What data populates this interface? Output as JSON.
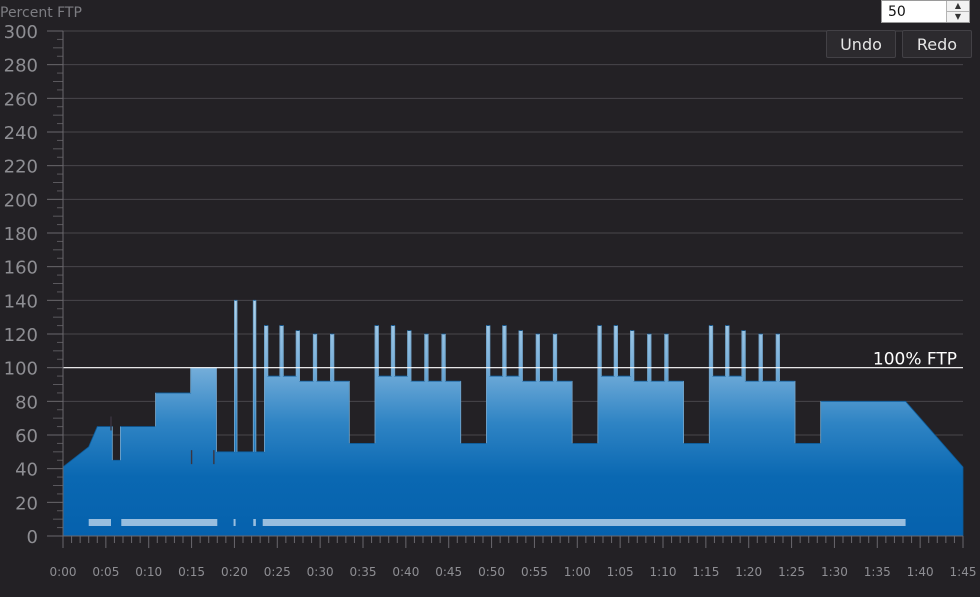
{
  "chart_data": {
    "type": "area",
    "title": "Percent FTP",
    "xlabel": "",
    "ylabel": "Percent FTP",
    "ylim": [
      0,
      300
    ],
    "xlim": [
      0,
      105
    ],
    "y_ticks": [
      0,
      20,
      40,
      60,
      80,
      100,
      120,
      140,
      160,
      180,
      200,
      220,
      240,
      260,
      280,
      300
    ],
    "x_tick_labels": [
      "0:00",
      "0:05",
      "0:10",
      "0:15",
      "0:20",
      "0:25",
      "0:30",
      "0:35",
      "0:40",
      "0:45",
      "0:50",
      "0:55",
      "1:00",
      "1:05",
      "1:10",
      "1:15",
      "1:20",
      "1:25",
      "1:30",
      "1:35",
      "1:40",
      "1:45"
    ],
    "grid": true,
    "reference_line": {
      "value": 100,
      "label": "100% FTP"
    },
    "color": "#1a6fb5",
    "profile": [
      [
        0.0,
        41
      ],
      [
        3.0,
        53
      ],
      [
        4.0,
        65
      ],
      [
        5.75,
        65
      ],
      [
        5.75,
        45
      ],
      [
        6.7,
        45
      ],
      [
        6.7,
        65
      ],
      [
        10.8,
        65
      ],
      [
        10.8,
        85
      ],
      [
        14.9,
        85
      ],
      [
        14.9,
        100
      ],
      [
        17.9,
        100
      ],
      [
        17.9,
        50
      ],
      [
        20.0,
        50
      ],
      [
        20.0,
        140
      ],
      [
        20.3,
        140
      ],
      [
        20.3,
        50
      ],
      [
        22.2,
        50
      ],
      [
        22.2,
        140
      ],
      [
        22.5,
        140
      ],
      [
        22.5,
        50
      ],
      [
        23.5,
        50
      ],
      [
        23.5,
        125
      ],
      [
        23.9,
        125
      ],
      [
        23.9,
        95
      ],
      [
        25.3,
        95
      ],
      [
        25.3,
        125
      ],
      [
        25.7,
        125
      ],
      [
        25.7,
        95
      ],
      [
        27.2,
        95
      ],
      [
        27.2,
        122
      ],
      [
        27.6,
        122
      ],
      [
        27.6,
        92
      ],
      [
        29.2,
        92
      ],
      [
        29.2,
        120
      ],
      [
        29.6,
        120
      ],
      [
        29.6,
        92
      ],
      [
        31.2,
        92
      ],
      [
        31.2,
        120
      ],
      [
        31.6,
        120
      ],
      [
        31.6,
        92
      ],
      [
        33.4,
        92
      ],
      [
        33.4,
        55
      ],
      [
        36.4,
        55
      ],
      [
        36.4,
        125
      ],
      [
        36.8,
        125
      ],
      [
        36.8,
        95
      ],
      [
        38.3,
        95
      ],
      [
        38.3,
        125
      ],
      [
        38.7,
        125
      ],
      [
        38.7,
        95
      ],
      [
        40.2,
        95
      ],
      [
        40.2,
        122
      ],
      [
        40.6,
        122
      ],
      [
        40.6,
        92
      ],
      [
        42.2,
        92
      ],
      [
        42.2,
        120
      ],
      [
        42.6,
        120
      ],
      [
        42.6,
        92
      ],
      [
        44.2,
        92
      ],
      [
        44.2,
        120
      ],
      [
        44.6,
        120
      ],
      [
        44.6,
        92
      ],
      [
        46.4,
        92
      ],
      [
        46.4,
        55
      ],
      [
        49.4,
        55
      ],
      [
        49.4,
        125
      ],
      [
        49.8,
        125
      ],
      [
        49.8,
        95
      ],
      [
        51.3,
        95
      ],
      [
        51.3,
        125
      ],
      [
        51.7,
        125
      ],
      [
        51.7,
        95
      ],
      [
        53.2,
        95
      ],
      [
        53.2,
        122
      ],
      [
        53.6,
        122
      ],
      [
        53.6,
        92
      ],
      [
        55.2,
        92
      ],
      [
        55.2,
        120
      ],
      [
        55.6,
        120
      ],
      [
        55.6,
        92
      ],
      [
        57.2,
        92
      ],
      [
        57.2,
        120
      ],
      [
        57.6,
        120
      ],
      [
        57.6,
        92
      ],
      [
        59.4,
        92
      ],
      [
        59.4,
        55
      ],
      [
        62.4,
        55
      ],
      [
        62.4,
        125
      ],
      [
        62.8,
        125
      ],
      [
        62.8,
        95
      ],
      [
        64.3,
        95
      ],
      [
        64.3,
        125
      ],
      [
        64.7,
        125
      ],
      [
        64.7,
        95
      ],
      [
        66.2,
        95
      ],
      [
        66.2,
        122
      ],
      [
        66.6,
        122
      ],
      [
        66.6,
        92
      ],
      [
        68.2,
        92
      ],
      [
        68.2,
        120
      ],
      [
        68.6,
        120
      ],
      [
        68.6,
        92
      ],
      [
        70.2,
        92
      ],
      [
        70.2,
        120
      ],
      [
        70.6,
        120
      ],
      [
        70.6,
        92
      ],
      [
        72.4,
        92
      ],
      [
        72.4,
        55
      ],
      [
        75.4,
        55
      ],
      [
        75.4,
        125
      ],
      [
        75.8,
        125
      ],
      [
        75.8,
        95
      ],
      [
        77.3,
        95
      ],
      [
        77.3,
        125
      ],
      [
        77.7,
        125
      ],
      [
        77.7,
        95
      ],
      [
        79.2,
        95
      ],
      [
        79.2,
        122
      ],
      [
        79.6,
        122
      ],
      [
        79.6,
        92
      ],
      [
        81.2,
        92
      ],
      [
        81.2,
        120
      ],
      [
        81.6,
        120
      ],
      [
        81.6,
        92
      ],
      [
        83.2,
        92
      ],
      [
        83.2,
        120
      ],
      [
        83.6,
        120
      ],
      [
        83.6,
        92
      ],
      [
        85.4,
        92
      ],
      [
        85.4,
        55
      ],
      [
        88.4,
        55
      ],
      [
        88.4,
        80
      ],
      [
        98.3,
        80
      ],
      [
        105.0,
        41
      ]
    ],
    "dark_marks": [
      [
        5.6,
        71
      ],
      [
        15.0,
        51
      ],
      [
        17.6,
        51
      ]
    ],
    "segment_bar": [
      [
        3.0,
        5.6
      ],
      [
        6.8,
        18.0
      ],
      [
        19.9,
        20.1
      ],
      [
        22.2,
        22.5
      ],
      [
        23.3,
        98.3
      ]
    ]
  },
  "controls": {
    "spin_value": "50",
    "undo_label": "Undo",
    "redo_label": "Redo",
    "up_arrow": "▲",
    "down_arrow": "▼"
  }
}
